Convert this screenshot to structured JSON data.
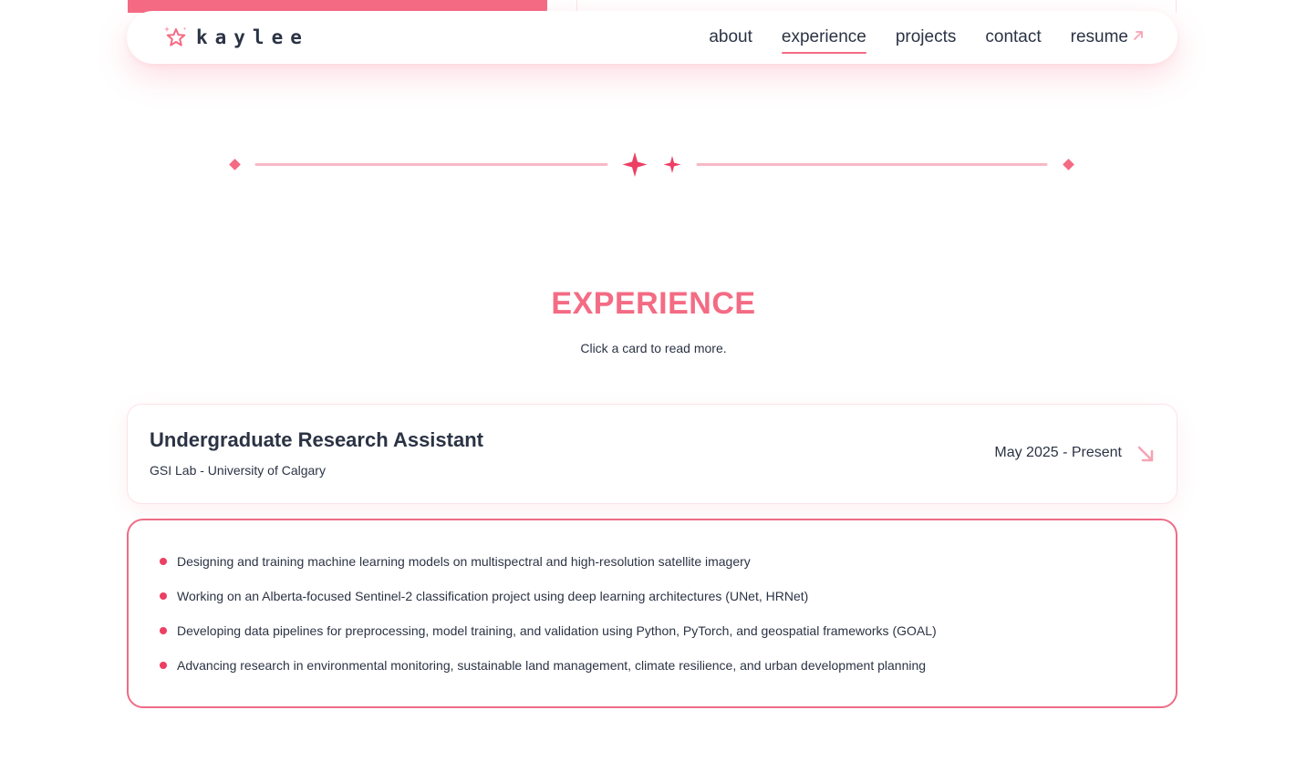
{
  "nav": {
    "brand": "kaylee",
    "links": [
      {
        "label": "about"
      },
      {
        "label": "experience",
        "active": true
      },
      {
        "label": "projects"
      },
      {
        "label": "contact"
      },
      {
        "label": "resume",
        "external": true
      }
    ]
  },
  "section": {
    "title": "EXPERIENCE",
    "subtitle": "Click a card to read more."
  },
  "experience": {
    "title": "Undergraduate Research Assistant",
    "org": "GSI Lab - University of Calgary",
    "dates": "May 2025 - Present",
    "bullets": [
      "Designing and training machine learning models on multispectral and high-resolution satellite imagery",
      "Working on an Alberta-focused Sentinel-2 classification project using deep learning architectures (UNet, HRNet)",
      "Developing data pipelines for preprocessing, model training, and validation using Python, PyTorch, and geospatial frameworks (GOAL)",
      "Advancing research in environmental monitoring, sustainable land management, climate resilience, and urban development planning"
    ]
  },
  "colors": {
    "accent": "#f46b84",
    "accent_dark": "#ec3f63",
    "text": "#2b3344",
    "divider_line": "#f7b9c6"
  },
  "icons": {
    "brand": "flower-star-icon",
    "resume": "arrow-up-right-icon",
    "card": "arrow-down-right-icon",
    "divider": "sparkle-icon"
  }
}
